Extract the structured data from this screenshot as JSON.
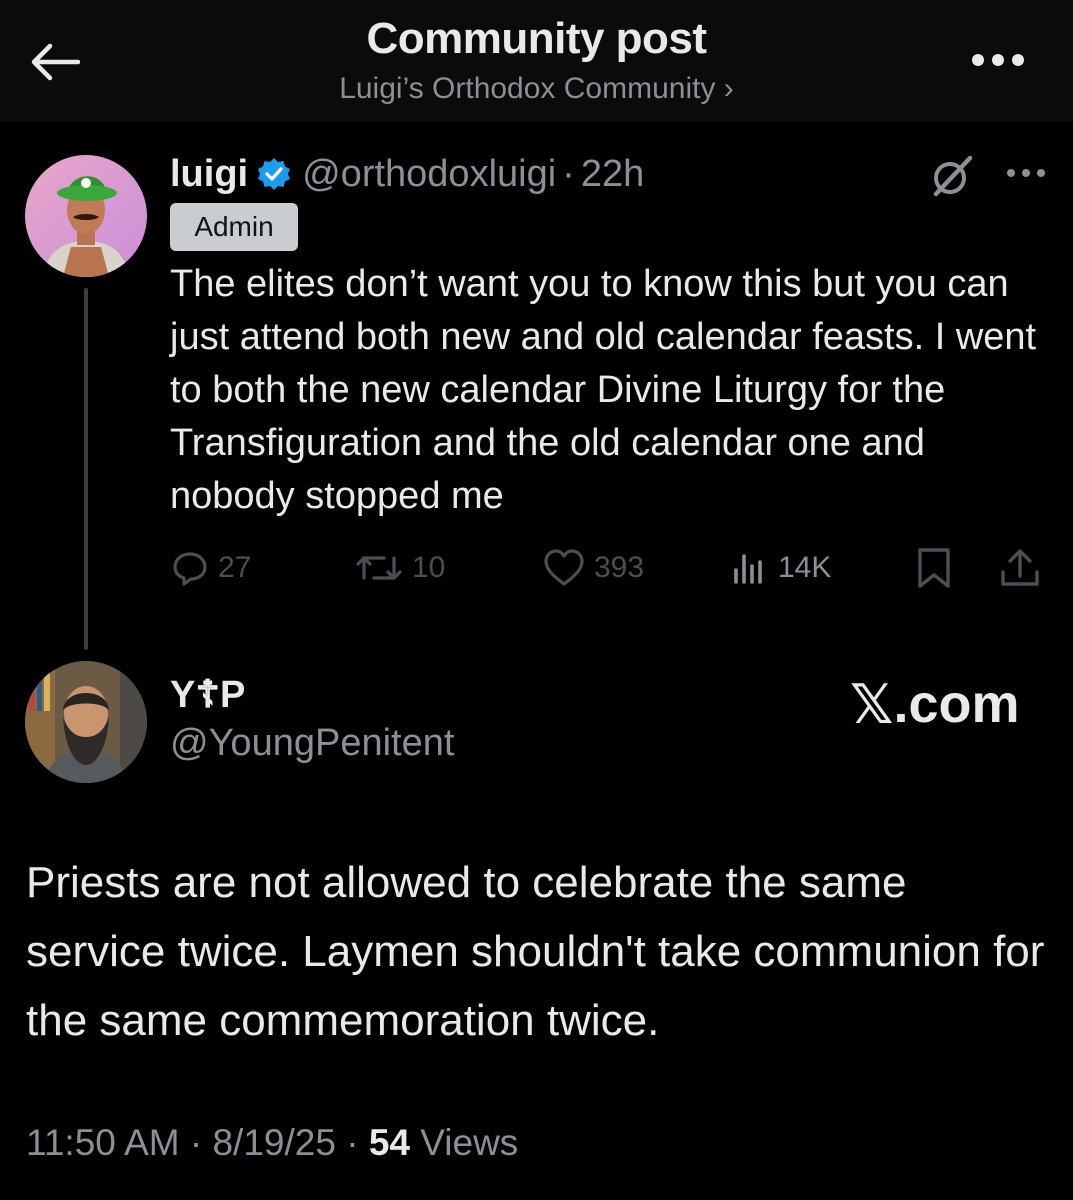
{
  "header": {
    "title": "Community post",
    "community": "Luigi’s Orthodox Community ›"
  },
  "post": {
    "name": "luigi",
    "handle": "@orthodoxluigi",
    "separator": "·",
    "time": "22h",
    "badge": "Admin",
    "text": "The elites don’t want you to know this but you can just attend both new and old calendar feasts. I went to both the new calendar Divine Liturgy for the Transfiguration and the old calendar one and nobody stopped me",
    "stats": {
      "replies": "27",
      "reposts": "10",
      "likes": "393",
      "views": "14K"
    }
  },
  "reply": {
    "name": "Y☦P",
    "handle": "@YoungPenitent",
    "watermark_x": "𝕏",
    "watermark_rest": ".com",
    "text": "Priests are not allowed to celebrate the same service twice.  Laymen shouldn't take communion for the same commemoration twice.",
    "time": "11:50 AM",
    "separator": "·",
    "date": "8/19/25",
    "views_count": "54",
    "views_label": "Views"
  },
  "colors": {
    "background": "#000000",
    "header_bg": "#0b0b0b",
    "text": "#e7e9ea",
    "secondary": "#8b9096",
    "verified": "#1d9bf0",
    "dim_actions": "#4b4f54"
  },
  "icons": [
    "back-arrow-icon",
    "more-icon",
    "verified-icon",
    "grok-icon",
    "reply-icon",
    "repost-icon",
    "like-icon",
    "views-icon",
    "bookmark-icon",
    "share-icon"
  ]
}
